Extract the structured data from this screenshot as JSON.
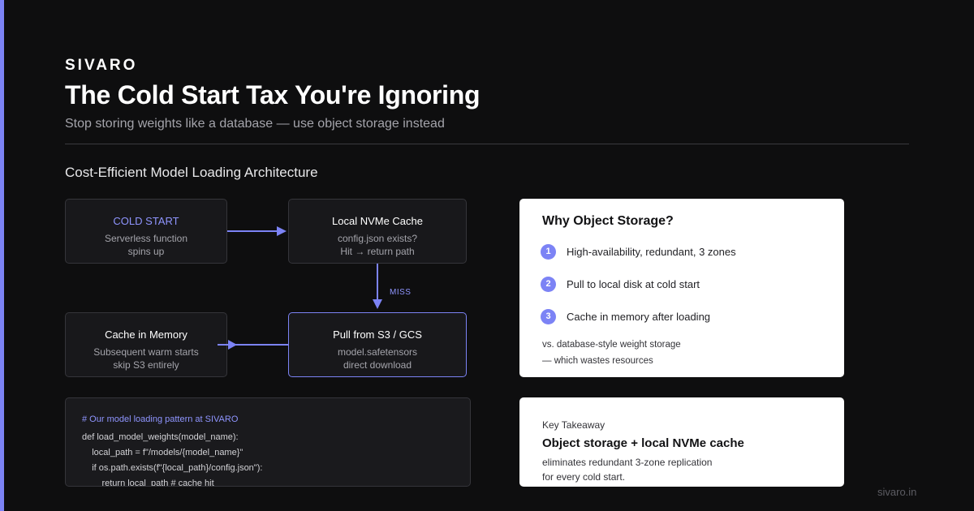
{
  "brand": "SIVARO",
  "header": {
    "title": "The Cold Start Tax You're Ignoring",
    "subtitle": "Stop storing weights like a database — use object storage instead"
  },
  "section_title": "Cost-Efficient Model Loading Architecture",
  "flow": {
    "cold_start": {
      "title": "COLD START",
      "lines": [
        "Serverless function",
        "spins up"
      ]
    },
    "nvme_cache": {
      "title": "Local NVMe Cache",
      "lines": [
        "config.json exists?",
        "Hit → return path"
      ]
    },
    "miss_label": "MISS",
    "pull_s3": {
      "title": "Pull from S3 / GCS",
      "lines": [
        "model.safetensors",
        "direct download"
      ]
    },
    "cache_memory": {
      "title": "Cache in Memory",
      "lines": [
        "Subsequent warm starts",
        "skip S3 entirely"
      ]
    }
  },
  "code": {
    "lines": [
      "# Our model loading pattern at SIVARO",
      "def load_model_weights(model_name):",
      "    local_path = f\"/models/{model_name}\"",
      "    if os.path.exists(f\"{local_path}/config.json\"):",
      "        return local_path # cache hit"
    ]
  },
  "why_card": {
    "title": "Why Object Storage?",
    "items": [
      {
        "num": "1",
        "text": "High-availability, redundant, 3 zones"
      },
      {
        "num": "2",
        "text": "Pull to local disk at cold start"
      },
      {
        "num": "3",
        "text": "Cache in memory after loading"
      }
    ],
    "note_lines": [
      "vs. database-style weight storage",
      "— which wastes resources"
    ]
  },
  "takeaway_card": {
    "kicker": "Key Takeaway",
    "headline": "Object storage + local NVMe cache",
    "lines": [
      "eliminates redundant 3-zone replication",
      "for every cold start."
    ]
  },
  "footer": "sivaro.in",
  "colors": {
    "accent": "#7c83f5",
    "background": "#0e0e0f",
    "card": "#ffffff"
  }
}
